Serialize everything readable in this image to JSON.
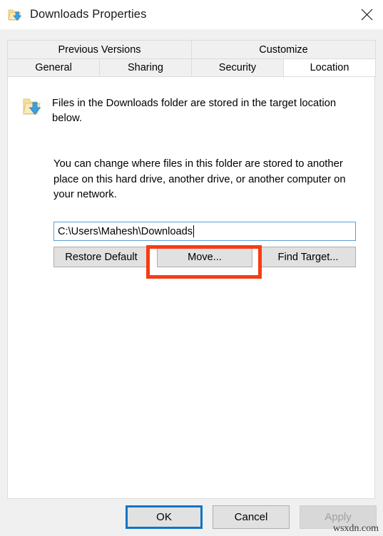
{
  "window": {
    "title": "Downloads Properties",
    "icon": "downloads-folder-icon",
    "close_label": "✕"
  },
  "tabs": {
    "row1": [
      {
        "label": "Previous Versions",
        "active": false
      },
      {
        "label": "Customize",
        "active": false
      }
    ],
    "row2": [
      {
        "label": "General",
        "active": false
      },
      {
        "label": "Sharing",
        "active": false
      },
      {
        "label": "Security",
        "active": false
      },
      {
        "label": "Location",
        "active": true
      }
    ]
  },
  "content": {
    "intro_text": "Files in the Downloads folder are stored in the target location below.",
    "description_text": "You can change where files in this folder are stored to another place on this hard drive, another drive, or another computer on your network.",
    "path_value": "C:\\Users\\Mahesh\\Downloads",
    "buttons": {
      "restore_default": "Restore Default",
      "move": "Move...",
      "find_target": "Find Target..."
    }
  },
  "footer": {
    "ok": "OK",
    "cancel": "Cancel",
    "apply": "Apply"
  },
  "annotation": {
    "color": "#f53d14",
    "targets": "move-button"
  },
  "watermark": "wsxdn.com"
}
